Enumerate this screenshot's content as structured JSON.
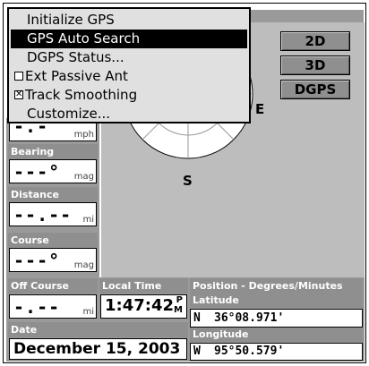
{
  "menu": {
    "items": [
      {
        "label": "Initialize GPS"
      },
      {
        "label": "GPS Auto Search"
      },
      {
        "label": "DGPS Status..."
      },
      {
        "label": "Ext Passive Ant",
        "checked": false
      },
      {
        "label": "Track Smoothing",
        "checked": true
      },
      {
        "label": "Customize..."
      }
    ],
    "check_mark": "✕"
  },
  "mode_buttons": {
    "b2d": "2D",
    "b3d": "3D",
    "dgps": "DGPS"
  },
  "sky": {
    "east": "E",
    "south": "S"
  },
  "gauges": {
    "speed": {
      "value": "-.-",
      "unit": "mph"
    },
    "bearing": {
      "label": "Bearing",
      "value": "---°",
      "unit": "mag"
    },
    "distance": {
      "label": "Distance",
      "value": "--.--",
      "unit": "mi"
    },
    "course": {
      "label": "Course",
      "value": "---°",
      "unit": "mag"
    }
  },
  "off_course": {
    "label": "Off Course",
    "value": "-.--",
    "unit": "mi"
  },
  "local_time": {
    "label": "Local Time",
    "value": "1:47:42",
    "ampm_top": "P",
    "ampm_bottom": "M"
  },
  "date": {
    "label": "Date",
    "value": "December 15, 2003"
  },
  "position": {
    "title": "Position - Degrees/Minutes",
    "lat_label": "Latitude",
    "lat_hemi": "N",
    "lat_value": "36°08.971'",
    "lon_label": "Longitude",
    "lon_hemi": "W",
    "lon_value": "95°50.579'"
  },
  "colors": {
    "panel": "#8f8f8f",
    "sky": "#bdbdbd",
    "selection": "#000000"
  }
}
